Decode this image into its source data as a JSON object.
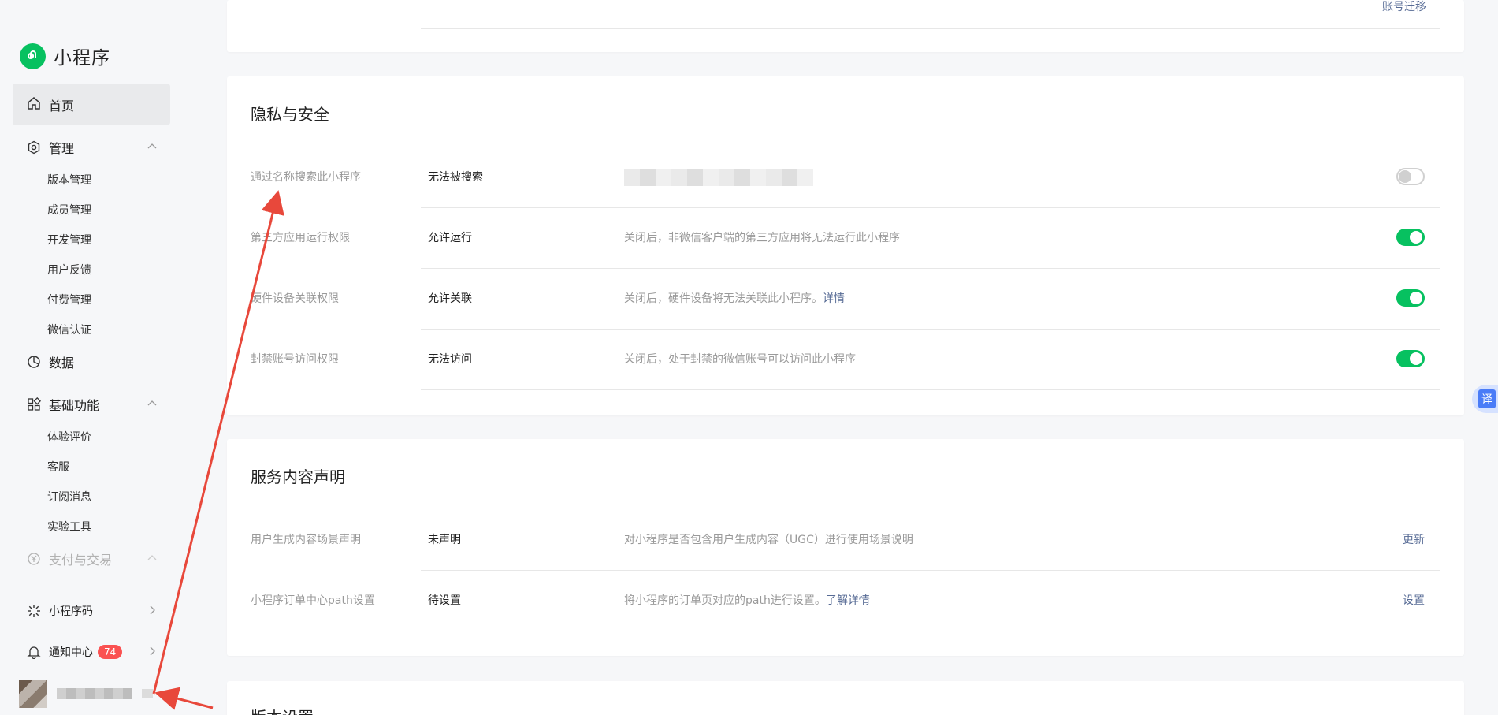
{
  "sidebar": {
    "app_name": "小程序",
    "home": "首页",
    "manage": {
      "label": "管理",
      "items": [
        "版本管理",
        "成员管理",
        "开发管理",
        "用户反馈",
        "付费管理",
        "微信认证"
      ]
    },
    "data": "数据",
    "basic": {
      "label": "基础功能",
      "items": [
        "体验评价",
        "客服",
        "订阅消息",
        "实验工具"
      ]
    },
    "payment": "支付与交易",
    "qrcode": "小程序码",
    "notify": {
      "label": "通知中心",
      "badge": "74"
    }
  },
  "top_card": {
    "link": "账号迁移"
  },
  "privacy": {
    "title": "隐私与安全",
    "rows": [
      {
        "name": "通过名称搜索此小程序",
        "status": "无法被搜索",
        "desc": "",
        "toggle": "off"
      },
      {
        "name": "第三方应用运行权限",
        "status": "允许运行",
        "desc": "关闭后，非微信客户端的第三方应用将无法运行此小程序",
        "toggle": "on"
      },
      {
        "name": "硬件设备关联权限",
        "status": "允许关联",
        "desc": "关闭后，硬件设备将无法关联此小程序。",
        "link": "详情",
        "toggle": "on"
      },
      {
        "name": "封禁账号访问权限",
        "status": "无法访问",
        "desc": "关闭后，处于封禁的微信账号可以访问此小程序",
        "toggle": "on"
      }
    ]
  },
  "service": {
    "title": "服务内容声明",
    "rows": [
      {
        "name": "用户生成内容场景声明",
        "status": "未声明",
        "desc": "对小程序是否包含用户生成内容（UGC）进行使用场景说明",
        "action": "更新"
      },
      {
        "name": "小程序订单中心path设置",
        "status": "待设置",
        "desc": "将小程序的订单页对应的path进行设置。",
        "link": "了解详情",
        "action": "设置"
      }
    ]
  },
  "version": {
    "title": "版本设置"
  },
  "translate": {
    "label": "译"
  },
  "colors": {
    "accent": "#07c160",
    "link": "#576b95",
    "badge": "#fa5151",
    "annotation": "#e8483b"
  }
}
